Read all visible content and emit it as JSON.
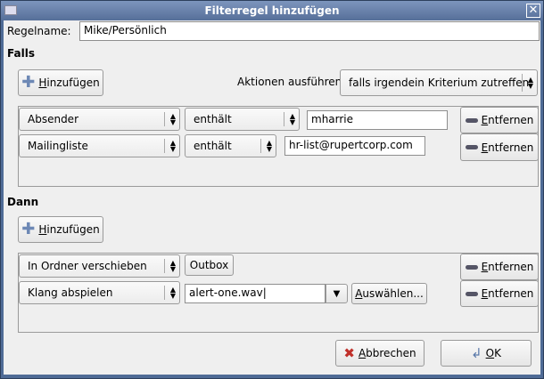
{
  "window": {
    "title": "Filterregel hinzufügen"
  },
  "rule_name": {
    "label": "Regelname:",
    "value": "Mike/Persönlich"
  },
  "falls": {
    "heading": "Falls",
    "add_label_u": "H",
    "add_label_rest": "inzufügen",
    "actions_label": "Aktionen ausführen",
    "match_mode": "falls irgendein Kriterium zutreffen",
    "criteria": [
      {
        "field": "Absender",
        "operator": "enthält",
        "value": "mharrie",
        "remove_u": "E",
        "remove_rest": "ntfernen"
      },
      {
        "field": "Mailingliste",
        "operator": "enthält",
        "value": "hr-list@rupertcorp.com",
        "remove_u": "E",
        "remove_rest": "ntfernen"
      }
    ]
  },
  "dann": {
    "heading": "Dann",
    "add_label_u": "H",
    "add_label_rest": "inzufügen",
    "actions": [
      {
        "action": "In Ordner verschieben",
        "folder": "Outbox",
        "remove_u": "E",
        "remove_rest": "ntfernen"
      },
      {
        "action": "Klang abspielen",
        "file": "alert-one.wav",
        "choose_u": "A",
        "choose_rest": "uswählen...",
        "remove_u": "E",
        "remove_rest": "ntfernen"
      }
    ]
  },
  "footer": {
    "cancel_u": "A",
    "cancel_rest": "bbrechen",
    "ok_u": "O",
    "ok_rest": "K"
  }
}
